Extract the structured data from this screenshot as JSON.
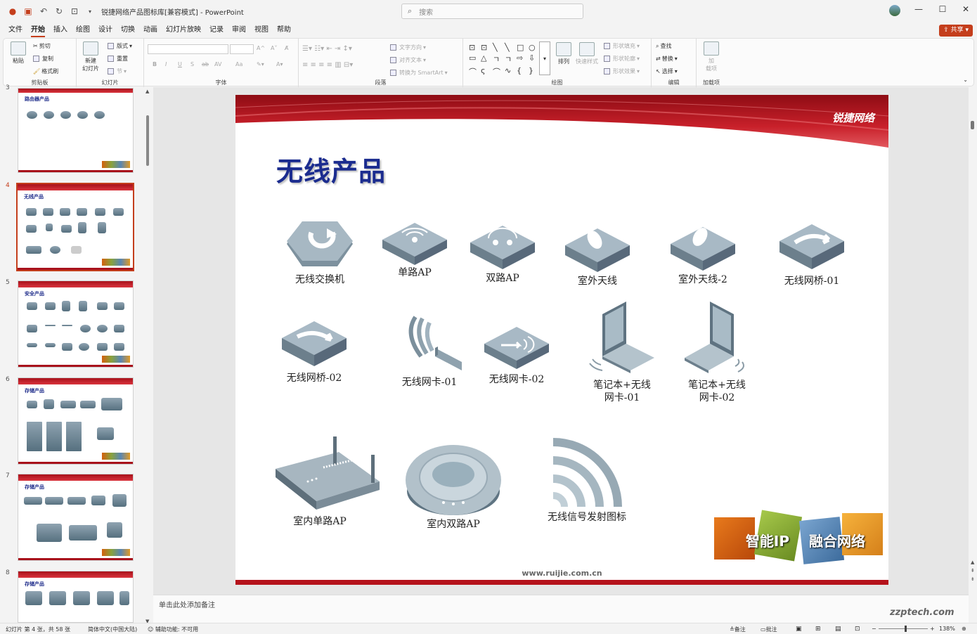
{
  "titlebar": {
    "doc_title": "锐捷网络产品图标库[兼容模式] - PowerPoint",
    "search_placeholder": "搜索",
    "qa_icons": [
      "powerpoint-logo-icon",
      "save-icon",
      "undo-icon",
      "redo-icon",
      "present-icon",
      "customize-icon"
    ],
    "minimize": "—",
    "restore": "☐",
    "close": "✕"
  },
  "menu": {
    "tabs": [
      "文件",
      "开始",
      "插入",
      "绘图",
      "设计",
      "切换",
      "动画",
      "幻灯片放映",
      "记录",
      "审阅",
      "视图",
      "帮助"
    ],
    "active": "开始",
    "share": "共享"
  },
  "ribbon": {
    "clipboard": {
      "paste": "粘贴",
      "cut": "剪切",
      "copy": "复制",
      "format_painter": "格式刷",
      "label": "剪贴板"
    },
    "slides": {
      "new_slide": "新建\n幻灯片",
      "layout": "版式",
      "reset": "重置",
      "section": "节",
      "label": "幻灯片"
    },
    "font": {
      "label": "字体",
      "bold": "B",
      "italic": "I",
      "underline": "U",
      "shadow": "S",
      "strike": "ab",
      "spacing": "AV",
      "case": "Aa",
      "grow": "A^",
      "shrink": "A˅"
    },
    "paragraph": {
      "text_direction": "文字方向",
      "align_text": "对齐文本",
      "smartart": "转换为 SmartArt",
      "label": "段落"
    },
    "drawing": {
      "arrange": "排列",
      "quick_styles": "快速样式",
      "shape_fill": "形状填充",
      "shape_outline": "形状轮廓",
      "shape_effects": "形状效果",
      "label": "绘图"
    },
    "editing": {
      "find": "查找",
      "replace": "替换",
      "select": "选择",
      "label": "编辑"
    },
    "addins": {
      "addins": "加\n载项",
      "label": "加载项"
    }
  },
  "thumbnails": [
    {
      "num": "3",
      "title": "路由器产品"
    },
    {
      "num": "4",
      "title": "无线产品",
      "selected": true
    },
    {
      "num": "5",
      "title": "安全产品"
    },
    {
      "num": "6",
      "title": "存储产品"
    },
    {
      "num": "7",
      "title": "存储产品"
    },
    {
      "num": "8",
      "title": "存储产品"
    }
  ],
  "slide": {
    "title": "无线产品",
    "brand": "锐捷网络",
    "website": "www.ruijie.com.cn",
    "promo": [
      "智能IP",
      "融合网络"
    ],
    "products": [
      {
        "label": "无线交换机",
        "icon": "wireless-switch-icon"
      },
      {
        "label": "单路AP",
        "icon": "single-ap-icon"
      },
      {
        "label": "双路AP",
        "icon": "dual-ap-icon"
      },
      {
        "label": "室外天线",
        "icon": "outdoor-antenna-icon"
      },
      {
        "label": "室外天线-2",
        "icon": "outdoor-antenna-2-icon"
      },
      {
        "label": "无线网桥-01",
        "icon": "wireless-bridge-01-icon"
      },
      {
        "label": "无线网桥-02",
        "icon": "wireless-bridge-02-icon"
      },
      {
        "label": "无线网卡-01",
        "icon": "wireless-nic-01-icon"
      },
      {
        "label": "无线网卡-02",
        "icon": "wireless-nic-02-icon"
      },
      {
        "label": "笔记本+无线\n网卡-01",
        "icon": "laptop-wireless-01-icon"
      },
      {
        "label": "笔记本+无线\n网卡-02",
        "icon": "laptop-wireless-02-icon"
      },
      {
        "label": "室内单路AP",
        "icon": "indoor-single-ap-icon"
      },
      {
        "label": "室内双路AP",
        "icon": "indoor-dual-ap-icon"
      },
      {
        "label": "无线信号发射图标",
        "icon": "wireless-signal-icon"
      }
    ]
  },
  "notes": {
    "placeholder": "单击此处添加备注"
  },
  "status": {
    "slide_info": "幻灯片 第 4 张，共 58 张",
    "language": "简体中文(中国大陆)",
    "accessibility": "辅助功能: 不可用",
    "notes": "备注",
    "comments": "批注",
    "zoom": "138%"
  },
  "watermark": "zzptech.com",
  "colors": {
    "accent": "#c43e1c",
    "title_blue": "#1b2c8f",
    "header_red": "#b5121b"
  }
}
